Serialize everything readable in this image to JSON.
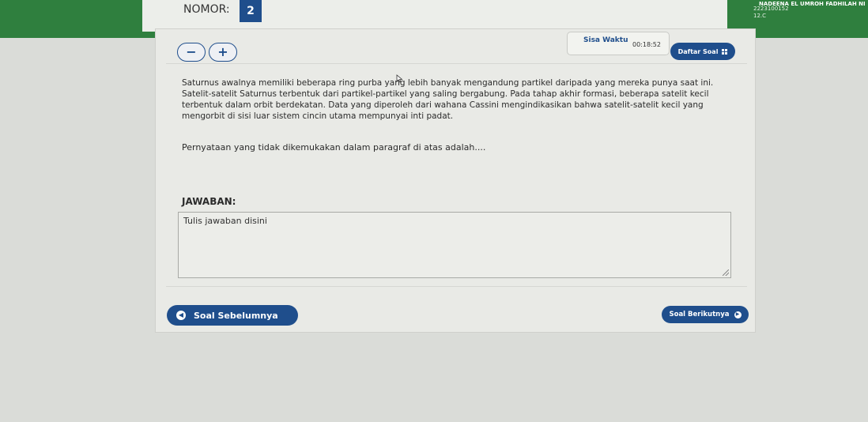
{
  "header": {
    "nomor_label": "NOMOR:",
    "nomor_value": "2",
    "user_name": "NADEENA EL UMROH FADHILAH NI",
    "user_id": "2223100152",
    "user_class": "12.C"
  },
  "toolbar": {
    "decrease_label": "−",
    "increase_label": "+",
    "timer_label": "Sisa Waktu",
    "timer_value": "00:18:52",
    "question_list_label": "Daftar Soal"
  },
  "question": {
    "text": "Saturnus awalnya memiliki beberapa ring purba yang lebih banyak mengandung partikel daripada yang mereka punya saat ini. Satelit-satelit Saturnus terbentuk dari partikel-partikel yang saling bergabung. Pada tahap akhir formasi, beberapa satelit kecil terbentuk dalam orbit berdekatan. Data yang diperoleh dari wahana Cassini mengindikasikan bahwa satelit-satelit kecil yang mengorbit di sisi luar sistem cincin utama mempunyai inti padat.",
    "prompt": "Pernyataan yang tidak dikemukakan dalam paragraf di atas adalah...."
  },
  "answer": {
    "label": "JAWABAN:",
    "placeholder": "Tulis jawaban disini",
    "value": ""
  },
  "navigation": {
    "prev_label": "Soal Sebelumnya",
    "next_label": "Soal Berikutnya"
  },
  "colors": {
    "primary": "#1f4e8c",
    "background_green": "#2f7f3e",
    "panel": "#e9eae6"
  },
  "icons": {
    "prev": "arrow-left-circle-icon",
    "next": "arrow-right-circle-icon",
    "list": "grid-icon",
    "cursor": "mouse-pointer-icon"
  }
}
